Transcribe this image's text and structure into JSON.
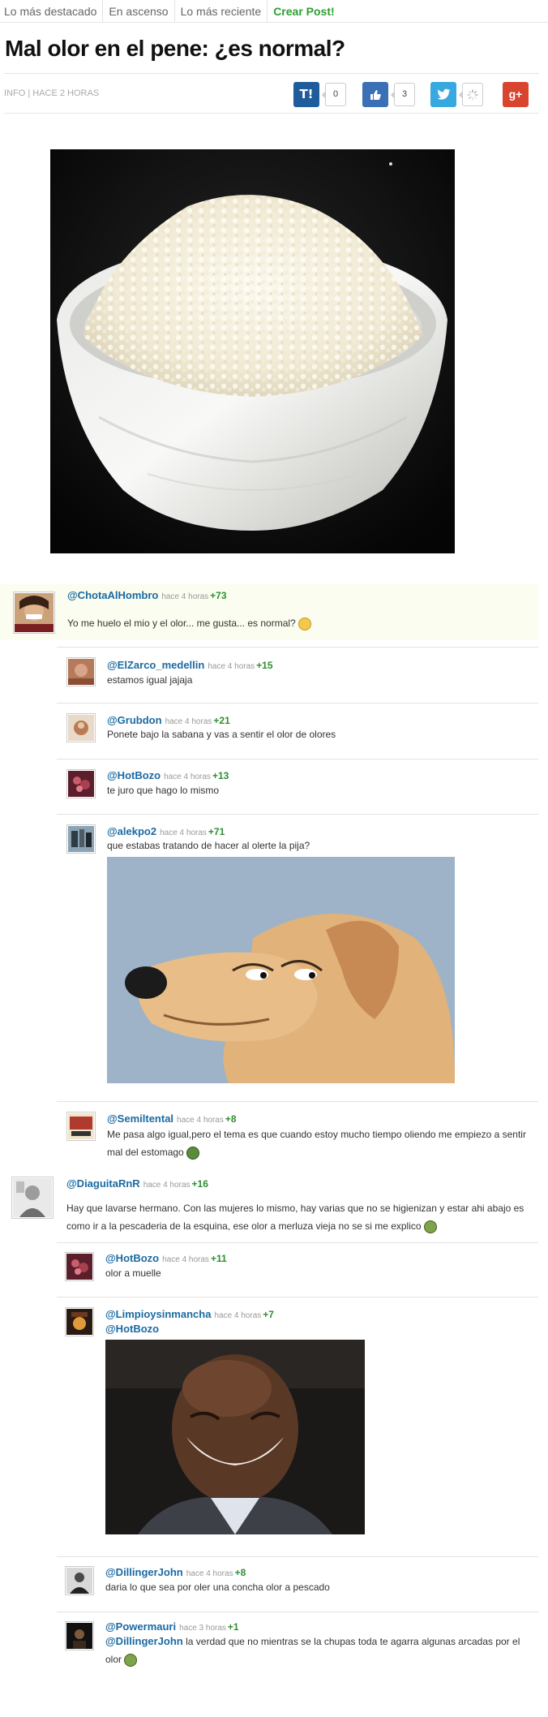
{
  "nav": {
    "tabs": [
      {
        "label": "Lo más destacado"
      },
      {
        "label": "En ascenso"
      },
      {
        "label": "Lo más reciente"
      },
      {
        "label": "Crear Post!"
      }
    ]
  },
  "post": {
    "title": "Mal olor en el pene: ¿es normal?",
    "meta": "INFO | HACE 2 HORAS",
    "taringa_count": "0",
    "facebook_count": "3"
  },
  "colors": {
    "taringa": "#1e5c9c",
    "facebook": "#3b6fb6",
    "twitter": "#38a8e0",
    "gplus": "#d9442f",
    "username": "#1a6aa2",
    "score": "#2e8e32"
  },
  "comments": [
    {
      "user": "@ChotaAlHombro",
      "time": "hace 4 horas",
      "score": "+73",
      "text": "Yo me huelo el mio y el olor... me gusta... es normal?"
    },
    {
      "user": "@ElZarco_medellin",
      "time": "hace 4 horas",
      "score": "+15",
      "text": "estamos igual jajaja"
    },
    {
      "user": "@Grubdon",
      "time": "hace 4 horas",
      "score": "+21",
      "text": "Ponete bajo la sabana y vas a sentir el olor de olores"
    },
    {
      "user": "@HotBozo",
      "time": "hace 4 horas",
      "score": "+13",
      "text": "te juro que hago lo mismo"
    },
    {
      "user": "@alekpo2",
      "time": "hace 4 horas",
      "score": "+71",
      "text": "que estabas tratando de hacer al olerte la pija?"
    },
    {
      "user": "@Semiltental",
      "time": "hace 4 horas",
      "score": "+8",
      "text": "Me pasa algo igual,pero el tema es que cuando estoy mucho tiempo oliendo me empiezo a sentir mal del estomago"
    },
    {
      "user": "@DiaguitaRnR",
      "time": "hace 4 horas",
      "score": "+16",
      "text": "Hay que lavarse hermano. Con las mujeres lo mismo, hay varias que no se higienizan y estar ahi abajo es como ir a la pescaderia de la esquina, ese olor a merluza vieja no se si me explico"
    },
    {
      "user": "@HotBozo",
      "time": "hace 4 horas",
      "score": "+11",
      "text": "olor a muelle"
    },
    {
      "user": "@Limpioysinmancha",
      "time": "hace 4 horas",
      "score": "+7",
      "mention": "@HotBozo"
    },
    {
      "user": "@DillingerJohn",
      "time": "hace 4 horas",
      "score": "+8",
      "text": "daria lo que sea por oler una concha olor a pescado"
    },
    {
      "user": "@Powermauri",
      "time": "hace 3 horas",
      "score": "+1",
      "mention": "@DillingerJohn",
      "text": "la verdad que no mientras se la chupas toda te agarra algunas arcadas por el olor"
    }
  ]
}
